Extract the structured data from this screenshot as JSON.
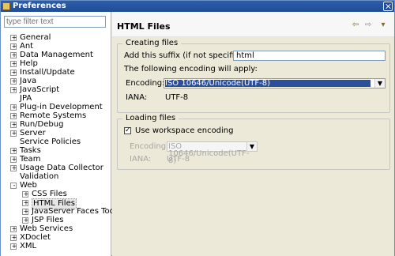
{
  "window": {
    "title": "Preferences"
  },
  "sidebar": {
    "filter_placeholder": "type filter text",
    "items": [
      {
        "label": "General",
        "toggle": "+"
      },
      {
        "label": "Ant",
        "toggle": "+"
      },
      {
        "label": "Data Management",
        "toggle": "+"
      },
      {
        "label": "Help",
        "toggle": "+"
      },
      {
        "label": "Install/Update",
        "toggle": "+"
      },
      {
        "label": "Java",
        "toggle": "+"
      },
      {
        "label": "JavaScript",
        "toggle": "+"
      },
      {
        "label": "JPA",
        "toggle": ""
      },
      {
        "label": "Plug-in Development",
        "toggle": "+"
      },
      {
        "label": "Remote Systems",
        "toggle": "+"
      },
      {
        "label": "Run/Debug",
        "toggle": "+"
      },
      {
        "label": "Server",
        "toggle": "+"
      },
      {
        "label": "Service Policies",
        "toggle": ""
      },
      {
        "label": "Tasks",
        "toggle": "+"
      },
      {
        "label": "Team",
        "toggle": "+"
      },
      {
        "label": "Usage Data Collector",
        "toggle": "+"
      },
      {
        "label": "Validation",
        "toggle": ""
      },
      {
        "label": "Web",
        "toggle": "-"
      },
      {
        "label": "CSS Files",
        "toggle": "+"
      },
      {
        "label": "HTML Files",
        "toggle": "+"
      },
      {
        "label": "JavaServer Faces Tool",
        "toggle": "+"
      },
      {
        "label": "JSP Files",
        "toggle": "+"
      },
      {
        "label": "Web Services",
        "toggle": "+"
      },
      {
        "label": "XDoclet",
        "toggle": "+"
      },
      {
        "label": "XML",
        "toggle": "+"
      }
    ]
  },
  "main": {
    "title": "HTML Files",
    "nav": {
      "back": "⇦",
      "forward": "⇨",
      "menu": "▾"
    },
    "creating": {
      "title": "Creating files",
      "suffix_label": "Add this suffix (if not specified):",
      "suffix_value": "html",
      "encoding_intro": "The following encoding will apply:",
      "encoding_label": "Encoding:",
      "encoding_value": "ISO 10646/Unicode(UTF-8)",
      "iana_label": "IANA:",
      "iana_value": "UTF-8"
    },
    "loading": {
      "title": "Loading files",
      "workspace_label": "Use workspace encoding",
      "workspace_checked": true,
      "encoding_label": "Encoding:",
      "encoding_value": "ISO 10646/Unicode(UTF-8)",
      "iana_label": "IANA:",
      "iana_value": "UTF-8"
    }
  }
}
